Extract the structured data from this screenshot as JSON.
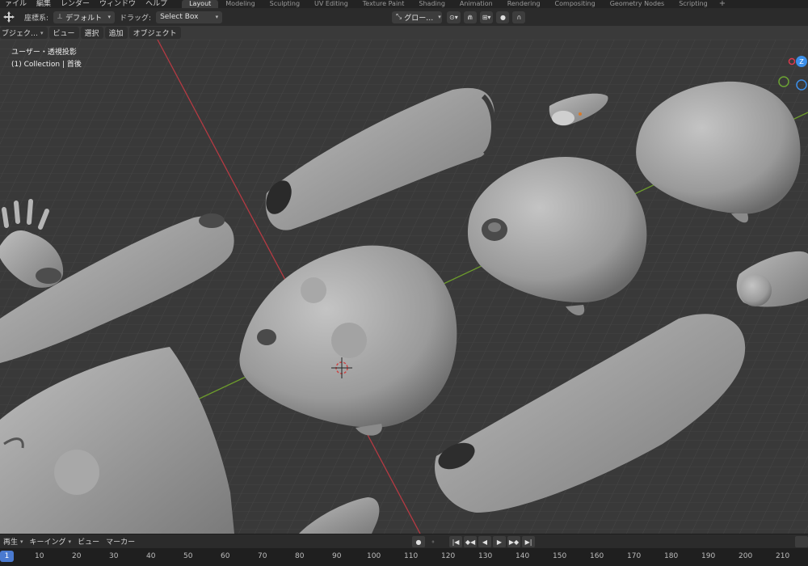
{
  "menu": {
    "items": [
      "ァイル",
      "編集",
      "レンダー",
      "ウィンドウ",
      "ヘルプ"
    ]
  },
  "workspaces": {
    "tabs": [
      "Layout",
      "Modeling",
      "Sculpting",
      "UV Editing",
      "Texture Paint",
      "Shading",
      "Animation",
      "Rendering",
      "Compositing",
      "Geometry Nodes",
      "Scripting"
    ],
    "active": "Layout",
    "add": "+"
  },
  "header": {
    "orientation_label": "座標系:",
    "orientation_value": "デフォルト",
    "drag_label": "ドラッグ:",
    "drag_value": "Select Box",
    "transform_value": "グロー…"
  },
  "subheader": {
    "mode": "ブジェク…",
    "view": "ビュー",
    "select": "選択",
    "add": "追加",
    "object": "オブジェクト"
  },
  "viewport": {
    "projection": "ユーザー・透視投影",
    "collection": "(1) Collection | 首後"
  },
  "gizmo": {
    "z_label": "Z",
    "x_color": "#e0384d",
    "y_color": "#6ca334",
    "z_color": "#3b8ee8"
  },
  "timeline": {
    "playback": "再生",
    "keying": "キーイング",
    "view": "ビュー",
    "marker": "マーカー"
  },
  "ruler": {
    "current": "1",
    "ticks": [
      "10",
      "20",
      "30",
      "40",
      "50",
      "60",
      "70",
      "80",
      "90",
      "100",
      "110",
      "120",
      "130",
      "140",
      "150",
      "160",
      "170",
      "180",
      "190",
      "200",
      "210"
    ]
  },
  "icons": {
    "transform": "move-icon",
    "dropdown": "chevron-down-icon"
  }
}
